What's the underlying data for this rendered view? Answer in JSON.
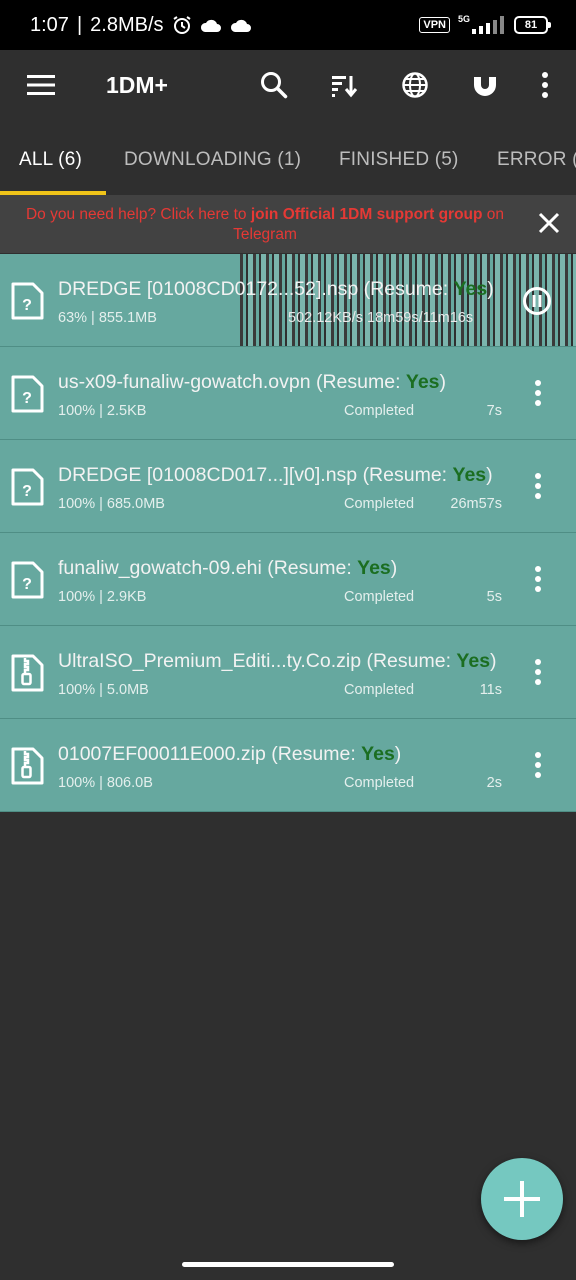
{
  "status_bar": {
    "time": "1:07",
    "speed": "2.8MB/s",
    "vpn": "VPN",
    "network": "5G",
    "battery": "81"
  },
  "app_bar": {
    "title": "1DM+",
    "icons": [
      "menu-icon",
      "search-icon",
      "sort-icon",
      "globe-icon",
      "magnet-icon",
      "more-vertical-icon"
    ]
  },
  "tabs": [
    {
      "label": "ALL (6)",
      "active": true
    },
    {
      "label": "DOWNLOADING (1)",
      "active": false
    },
    {
      "label": "FINISHED (5)",
      "active": false
    },
    {
      "label": "ERROR (",
      "active": false
    }
  ],
  "banner": {
    "text_prefix": "Do you need help? Click here to ",
    "text_bold": "join Official 1DM support group",
    "text_suffix": " on Telegram"
  },
  "downloads": [
    {
      "name": "DREDGE [01008CD0172...52].nsp (Resume: ",
      "resume": "Yes",
      "name_end": ")",
      "info": "63% | 855.1MB",
      "status": "",
      "speed": "502.12KB/s  18m59s/11m16s",
      "time": "",
      "active": true,
      "progress": 0.63,
      "icon": "file-unknown-icon"
    },
    {
      "name": "us-x09-funaliw-gowatch.ovpn (Resume: ",
      "resume": "Yes",
      "name_end": ")",
      "info": "100% | 2.5KB",
      "status": "Completed",
      "time": "7s",
      "active": false,
      "icon": "file-unknown-icon"
    },
    {
      "name": "DREDGE [01008CD017...][v0].nsp (Resume: ",
      "resume": "Yes",
      "name_end": ")",
      "info": "100% | 685.0MB",
      "status": "Completed",
      "time": "26m57s",
      "active": false,
      "icon": "file-unknown-icon"
    },
    {
      "name": "funaliw_gowatch-09.ehi (Resume: ",
      "resume": "Yes",
      "name_end": ")",
      "info": "100% | 2.9KB",
      "status": "Completed",
      "time": "5s",
      "active": false,
      "icon": "file-unknown-icon"
    },
    {
      "name": "UltraISO_Premium_Editi...ty.Co.zip (Resume: ",
      "resume": "Yes",
      "name_end": ")",
      "info": "100% | 5.0MB",
      "status": "Completed",
      "time": "11s",
      "active": false,
      "icon": "file-zip-icon"
    },
    {
      "name": "01007EF00011E000.zip (Resume: ",
      "resume": "Yes",
      "name_end": ")",
      "info": "100% | 806.0B",
      "status": "Completed",
      "time": "2s",
      "active": false,
      "icon": "file-zip-icon"
    }
  ],
  "fab": {
    "icon": "plus-icon"
  },
  "colors": {
    "accent": "#f0c419",
    "row_bg": "#66a89f",
    "resume_yes": "#1b6e21",
    "banner_text": "#e53935",
    "fab": "#75c8c0"
  }
}
